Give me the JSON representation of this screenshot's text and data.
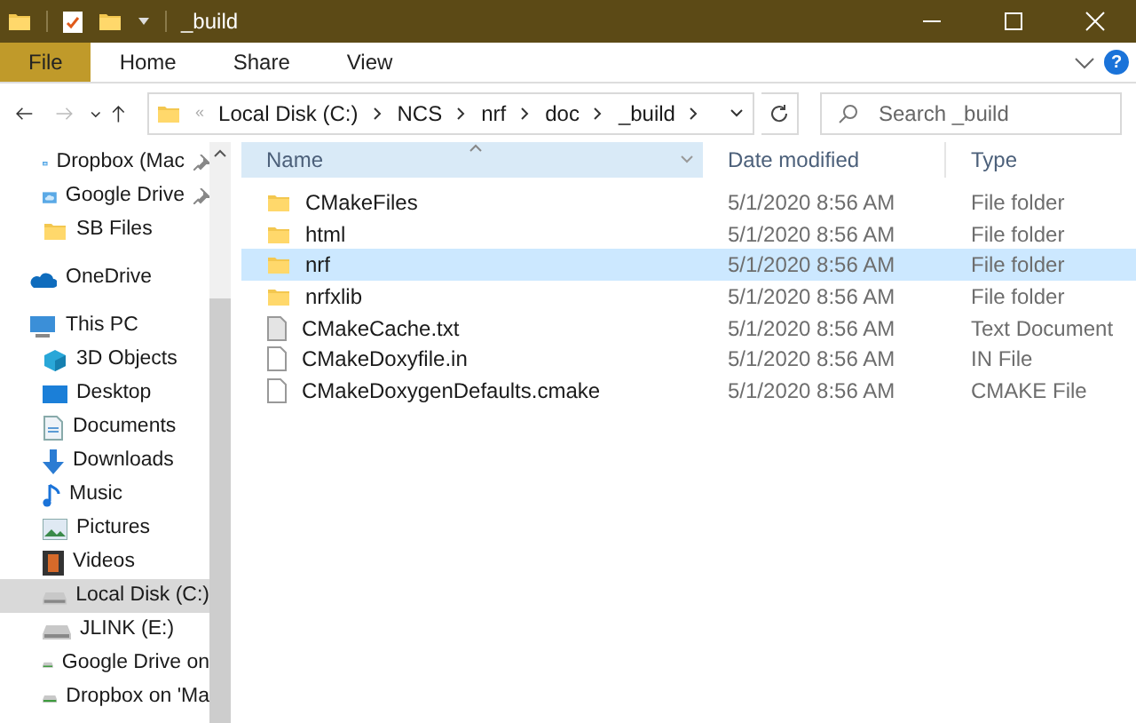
{
  "window": {
    "title": "_build"
  },
  "ribbon": {
    "tabs": [
      {
        "label": "File",
        "selected": true
      },
      {
        "label": "Home",
        "selected": false
      },
      {
        "label": "Share",
        "selected": false
      },
      {
        "label": "View",
        "selected": false
      }
    ],
    "help": "?"
  },
  "address_bar": {
    "overflow": "«",
    "crumbs": [
      "Local Disk (C:)",
      "NCS",
      "nrf",
      "doc",
      "_build"
    ]
  },
  "search": {
    "placeholder": "Search _build"
  },
  "sidebar": {
    "items": [
      {
        "label": "Dropbox (Mac",
        "kind": "cloud",
        "pinned": true,
        "selected": false
      },
      {
        "label": "Google Drive",
        "kind": "cloud",
        "pinned": true,
        "selected": false
      },
      {
        "label": "SB Files",
        "kind": "folder",
        "pinned": false,
        "selected": false
      },
      {
        "label": "OneDrive",
        "kind": "onedrive",
        "pinned": false,
        "selected": false
      },
      {
        "label": "This PC",
        "kind": "pc",
        "pinned": false,
        "selected": false
      },
      {
        "label": "3D Objects",
        "kind": "objects",
        "pinned": false,
        "selected": false
      },
      {
        "label": "Desktop",
        "kind": "desktop",
        "pinned": false,
        "selected": false
      },
      {
        "label": "Documents",
        "kind": "documents",
        "pinned": false,
        "selected": false
      },
      {
        "label": "Downloads",
        "kind": "downloads",
        "pinned": false,
        "selected": false
      },
      {
        "label": "Music",
        "kind": "music",
        "pinned": false,
        "selected": false
      },
      {
        "label": "Pictures",
        "kind": "pictures",
        "pinned": false,
        "selected": false
      },
      {
        "label": "Videos",
        "kind": "videos",
        "pinned": false,
        "selected": false
      },
      {
        "label": "Local Disk (C:)",
        "kind": "drive",
        "pinned": false,
        "selected": true
      },
      {
        "label": "JLINK (E:)",
        "kind": "drive",
        "pinned": false,
        "selected": false
      },
      {
        "label": "Google Drive on",
        "kind": "netdrive",
        "pinned": false,
        "selected": false
      },
      {
        "label": "Dropbox on 'Ma",
        "kind": "netdrive",
        "pinned": false,
        "selected": false
      }
    ]
  },
  "table": {
    "columns": [
      {
        "label": "Name",
        "selected": true
      },
      {
        "label": "Date modified",
        "selected": false
      },
      {
        "label": "Type",
        "selected": false
      }
    ],
    "rows": [
      {
        "name": "CMakeFiles",
        "date": "5/1/2020 8:56 AM",
        "type": "File folder",
        "kind": "folder",
        "selected": false
      },
      {
        "name": "html",
        "date": "5/1/2020 8:56 AM",
        "type": "File folder",
        "kind": "folder",
        "selected": false
      },
      {
        "name": "nrf",
        "date": "5/1/2020 8:56 AM",
        "type": "File folder",
        "kind": "folder",
        "selected": true
      },
      {
        "name": "nrfxlib",
        "date": "5/1/2020 8:56 AM",
        "type": "File folder",
        "kind": "folder",
        "selected": false
      },
      {
        "name": "CMakeCache.txt",
        "date": "5/1/2020 8:56 AM",
        "type": "Text Document",
        "kind": "text",
        "selected": false
      },
      {
        "name": "CMakeDoxyfile.in",
        "date": "5/1/2020 8:56 AM",
        "type": "IN File",
        "kind": "file",
        "selected": false
      },
      {
        "name": "CMakeDoxygenDefaults.cmake",
        "date": "5/1/2020 8:56 AM",
        "type": "CMAKE File",
        "kind": "file",
        "selected": false
      }
    ]
  }
}
